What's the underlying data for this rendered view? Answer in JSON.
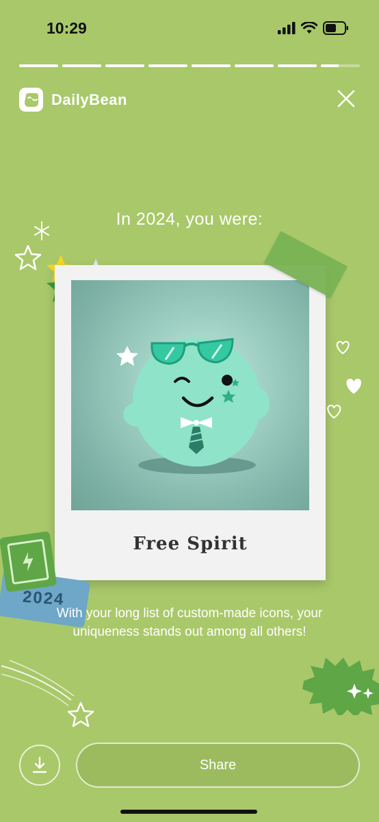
{
  "status_bar": {
    "time": "10:29",
    "icons": [
      "cellular-signal-icon",
      "wifi-icon",
      "battery-icon"
    ]
  },
  "progress": {
    "segments": 8,
    "active_segment": 8,
    "active_fill_fraction": 0.45
  },
  "header": {
    "app_name": "DailyBean",
    "logo_icon": "bean-logo-icon",
    "close_icon": "close-icon"
  },
  "headline": "In 2024, you were:",
  "card": {
    "title": "Free Spirit",
    "character": "winking-bean-with-sunglasses-illustration"
  },
  "description": "With your long list of custom-made icons, your uniqueness stands out among all others!",
  "stickers": {
    "ticket_text": "2024"
  },
  "actions": {
    "download_icon": "download-icon",
    "share_label": "Share"
  },
  "colors": {
    "background": "#a9c86a",
    "photo": "#9fd0c3",
    "bean": "#8fe3c8",
    "accent_green": "#5fa647"
  }
}
